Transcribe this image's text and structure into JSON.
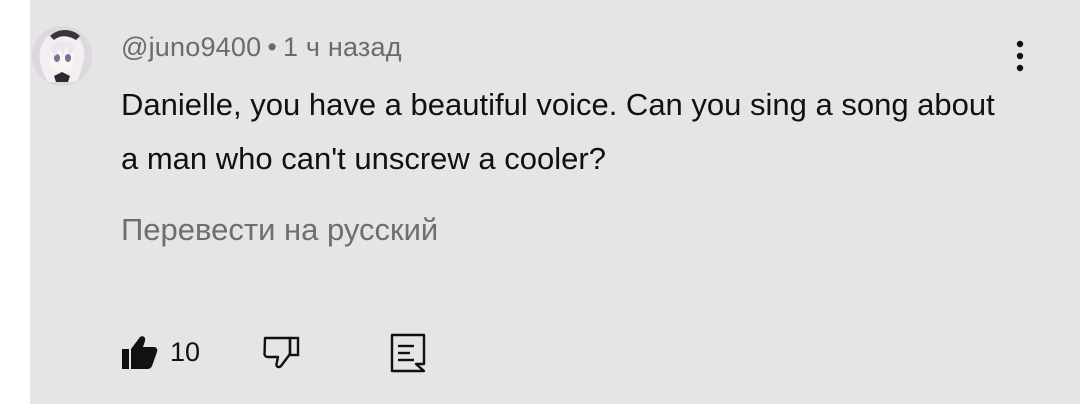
{
  "comment": {
    "author": "@juno9400",
    "separator": "•",
    "timestamp": "1 ч назад",
    "text": "Danielle, you have a beautiful voice. Can you sing a song about a man who can't unscrew a cooler?",
    "translate_label": "Перевести на русский",
    "like_count": "10"
  },
  "icons": {
    "avatar": "anime-avatar",
    "menu": "more-vert-icon",
    "like": "thumb-up-filled-icon",
    "dislike": "thumb-down-outline-icon",
    "reply": "reply-comment-icon"
  },
  "colors": {
    "background": "#e5e5e5",
    "text": "#111111",
    "secondary_text": "#6b6b6b"
  }
}
